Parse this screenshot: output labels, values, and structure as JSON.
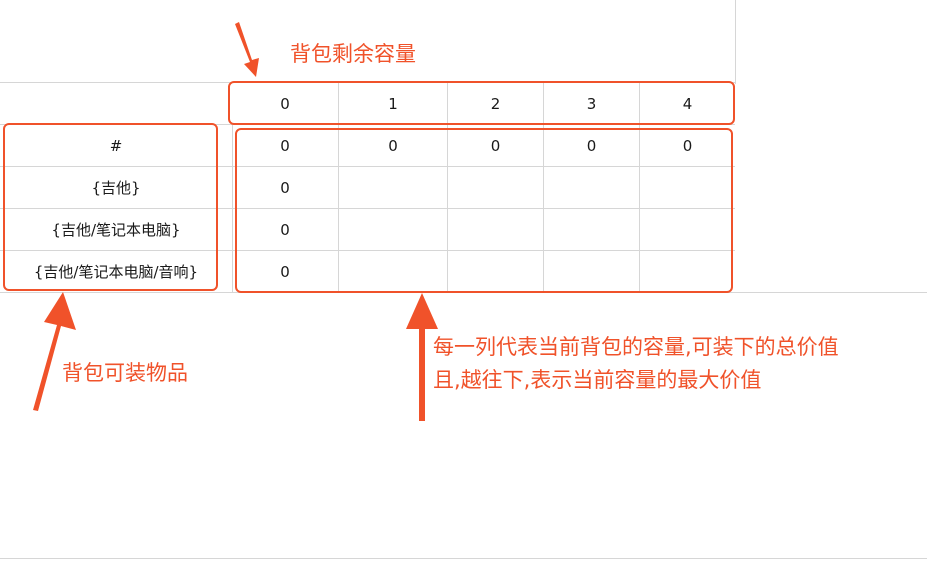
{
  "annotations": {
    "capacity_title": "背包剩余容量",
    "items_label": "背包可装物品",
    "explanation": [
      "每一列代表当前背包的容量,可装下的总价值",
      "且,越往下,表示当前容量的最大价值"
    ]
  },
  "table": {
    "capacity_headers": [
      "0",
      "1",
      "2",
      "3",
      "4"
    ],
    "row_labels": [
      "#",
      "{吉他}",
      "{吉他/笔记本电脑}",
      "{吉他/笔记本电脑/音响}"
    ],
    "rows": [
      [
        "0",
        "0",
        "0",
        "0",
        "0"
      ],
      [
        "0",
        "",
        "",
        "",
        ""
      ],
      [
        "0",
        "",
        "",
        "",
        ""
      ],
      [
        "0",
        "",
        "",
        "",
        ""
      ]
    ]
  },
  "colors": {
    "accent": "#f0522a",
    "grid": "#d6d6d6"
  }
}
